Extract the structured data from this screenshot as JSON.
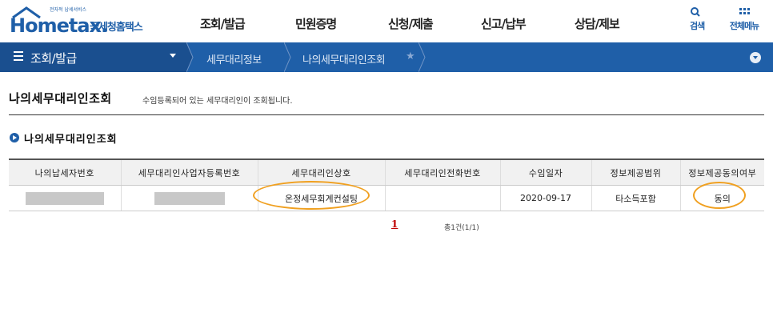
{
  "logo": {
    "small_text": "전자적 납세서비스",
    "brand": "Hometax.",
    "korean": "국세청홈택스"
  },
  "main_nav": [
    "조회/발급",
    "민원증명",
    "신청/제출",
    "신고/납부",
    "상담/제보"
  ],
  "tools": {
    "search_label": "검색",
    "all_menu_label": "전체메뉴"
  },
  "subnav": {
    "menu_title": "조회/발급",
    "breadcrumb": [
      "세무대리정보",
      "나의세무대리인조회"
    ]
  },
  "page": {
    "title": "나의세무대리인조회",
    "description": "수임등록되어 있는 세무대리인이 조회됩니다."
  },
  "section": {
    "title": "나의세무대리인조회"
  },
  "table": {
    "headers": [
      "나의납세자번호",
      "세무대리인사업자등록번호",
      "세무대리인상호",
      "세무대리인전화번호",
      "수임일자",
      "정보제공범위",
      "정보제공동의여부"
    ],
    "rows": [
      {
        "taxpayer_no": "",
        "agent_reg_no": "",
        "agent_name": "온정세무회계컨설팅",
        "agent_phone": "",
        "date": "2020-09-17",
        "scope": "타소득포함",
        "consent": "동의"
      }
    ]
  },
  "pagination": {
    "current": "1",
    "total": "총1건(1/1)"
  },
  "colors": {
    "brand_blue": "#1f5fa8",
    "highlight": "#f0a020",
    "page_link": "#c00000"
  }
}
